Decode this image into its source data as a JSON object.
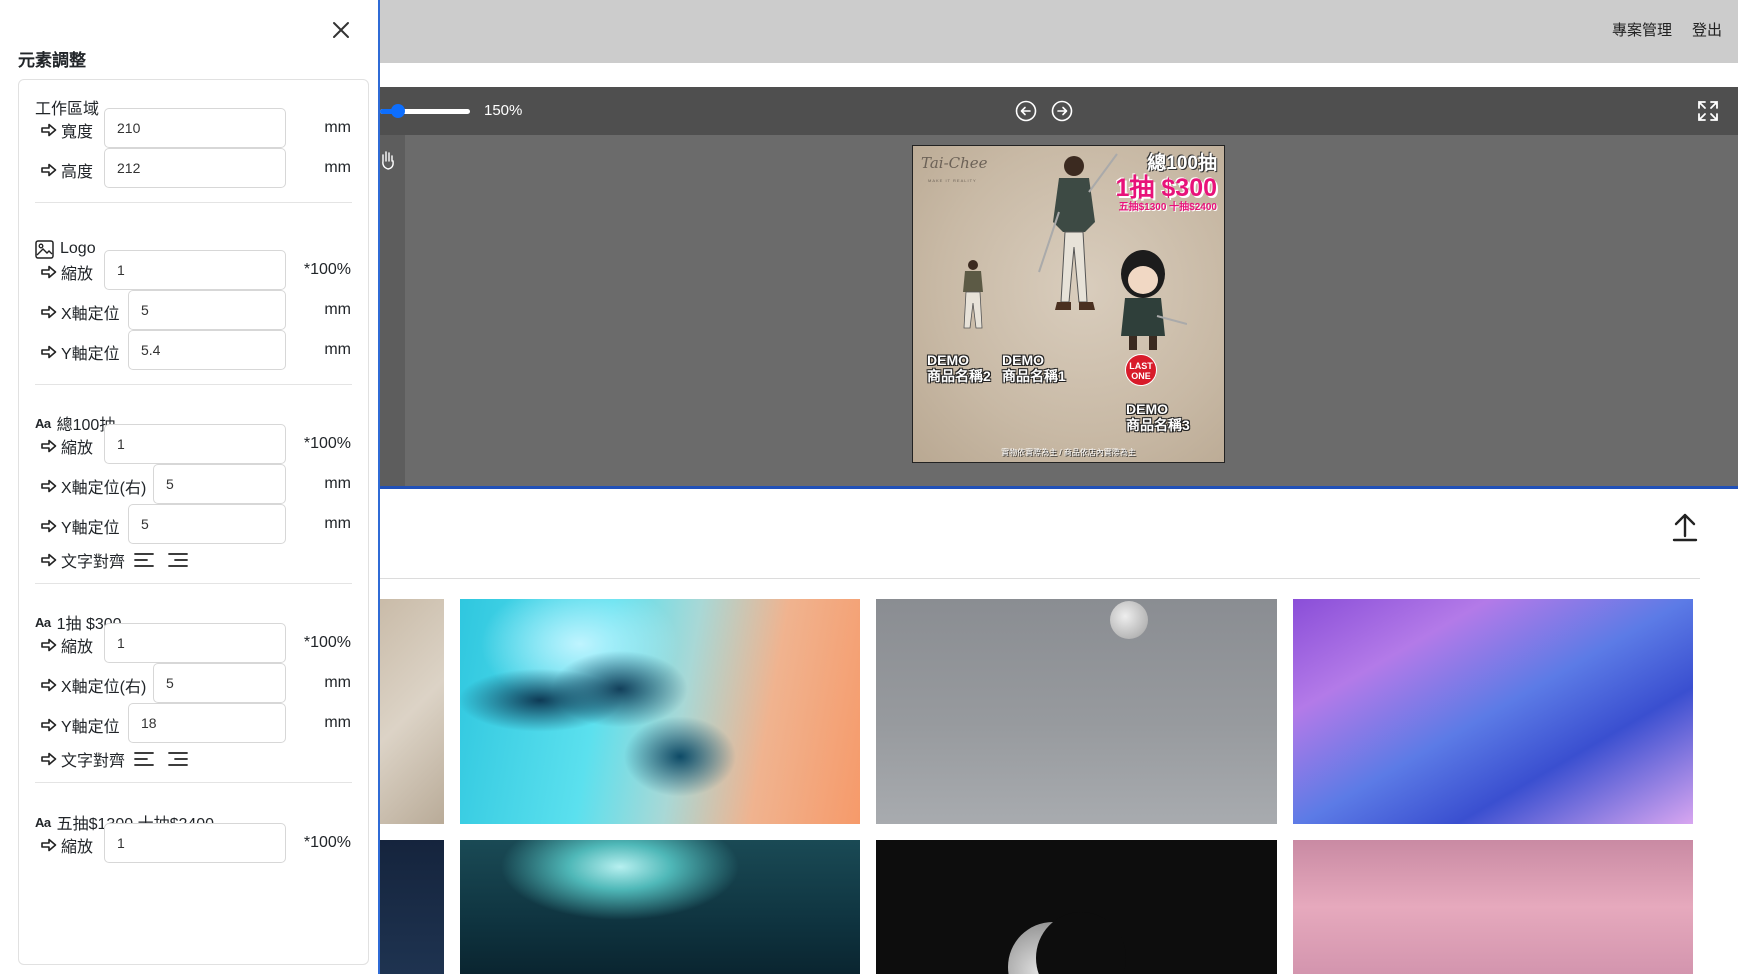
{
  "header": {
    "nav": [
      "專案管理",
      "登出"
    ]
  },
  "editor": {
    "zoom_label": "150%",
    "zoom_fraction": 0.2,
    "poster": {
      "logo_text": "Tai-Chee",
      "logo_sub": "MAKE IT REALITY",
      "title_1": "總100抽",
      "title_2": "1抽 $300",
      "title_3": "五抽$1300 十抽$2400",
      "badge": [
        "LAST",
        "ONE"
      ],
      "names": [
        {
          "line1": "DEMO",
          "line2": "商品名稱2"
        },
        {
          "line1": "DEMO",
          "line2": "商品名稱1"
        },
        {
          "line1": "DEMO",
          "line2": "商品名稱3"
        }
      ],
      "footer": "實物依實際為主 / 商品依店內實際為主"
    }
  },
  "sidebar": {
    "title": "元素調整",
    "sections": [
      {
        "label": "工作區域",
        "icon": "none",
        "rows": [
          {
            "label": "寬度",
            "value": "210",
            "unit": "mm"
          },
          {
            "label": "高度",
            "value": "212",
            "unit": "mm"
          }
        ]
      },
      {
        "label": "Logo",
        "icon": "image-icon",
        "rows": [
          {
            "label": "縮放",
            "value": "1",
            "unit": "*100%"
          },
          {
            "label": "X軸定位",
            "value": "5",
            "unit": "mm"
          },
          {
            "label": "Y軸定位",
            "value": "5.4",
            "unit": "mm"
          }
        ]
      },
      {
        "label": "總100抽",
        "icon": "text-icon",
        "rows": [
          {
            "label": "縮放",
            "value": "1",
            "unit": "*100%"
          },
          {
            "label": "X軸定位(右)",
            "value": "5",
            "unit": "mm"
          },
          {
            "label": "Y軸定位",
            "value": "5",
            "unit": "mm"
          }
        ],
        "align_label": "文字對齊"
      },
      {
        "label": "1抽 $300",
        "icon": "text-icon",
        "rows": [
          {
            "label": "縮放",
            "value": "1",
            "unit": "*100%"
          },
          {
            "label": "X軸定位(右)",
            "value": "5",
            "unit": "mm"
          },
          {
            "label": "Y軸定位",
            "value": "18",
            "unit": "mm"
          }
        ],
        "align_label": "文字對齊"
      },
      {
        "label": "五抽$1300 十抽$2400",
        "icon": "text-icon",
        "rows": [
          {
            "label": "縮放",
            "value": "1",
            "unit": "*100%"
          }
        ]
      }
    ]
  },
  "text_icon_glyph": "Aa",
  "colors": {
    "accent": "#0d6efd",
    "sidebar_border": "#2f6bd6",
    "editor_bg": "#5d5d5d",
    "header_bg": "#cccccc"
  }
}
